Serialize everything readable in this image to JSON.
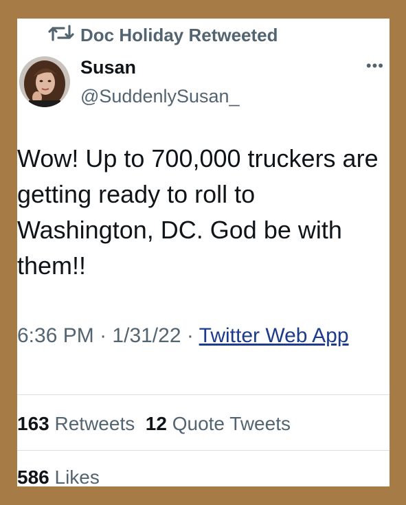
{
  "retweet": {
    "label": "Doc Holiday Retweeted"
  },
  "author": {
    "name": "Susan",
    "handle": "@SuddenlySusan_"
  },
  "tweet": {
    "text": "Wow! Up to 700,000 truckers are getting ready to roll to Washington, DC. God be with them!!",
    "time": "6:36 PM",
    "date": "1/31/22",
    "source": "Twitter Web App"
  },
  "stats": {
    "retweets_count": "163",
    "retweets_label": "Retweets",
    "quotes_count": "12",
    "quotes_label": "Quote Tweets",
    "likes_count": "586",
    "likes_label": "Likes"
  },
  "icons": {
    "retweet": "retweet-icon",
    "more": "more-icon"
  },
  "colors": {
    "frame": "#a77b45",
    "link": "#1d3b8c",
    "muted": "#536471"
  }
}
